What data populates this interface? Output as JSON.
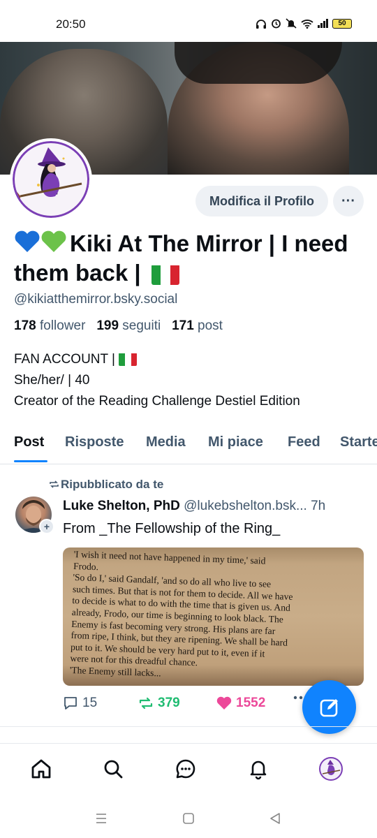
{
  "status_bar": {
    "time": "20:50",
    "battery": "50"
  },
  "profile": {
    "display_name": "Kiki At The Mirror | I need them back |",
    "handle": "@kikiatthemirror.bsky.social",
    "edit_button": "Modifica il Profilo",
    "more_button": "···",
    "stats": {
      "followers_count": "178",
      "followers_label": "follower",
      "following_count": "199",
      "following_label": "seguiti",
      "posts_count": "171",
      "posts_label": "post"
    },
    "bio": {
      "line1": "FAN ACCOUNT |",
      "line2": "She/her/ | 40",
      "line3": "Creator of the Reading Challenge Destiel Edition"
    }
  },
  "tabs": [
    "Post",
    "Risposte",
    "Media",
    "Mi piace",
    "Feed",
    "Starter"
  ],
  "active_tab": "Post",
  "post": {
    "repost_label": "Ripubblicato da te",
    "author": "Luke Shelton, PhD",
    "author_handle": "@lukebshelton.bsk...",
    "time": "7h",
    "text": "From _The Fellowship of the Ring_",
    "image_text": "'I wish it need not have happened in my time,' said\nFrodo.\n'So do I,' said Gandalf, 'and so do all who live to see\nsuch times. But that is not for them to decide. All we have\nto decide is what to do with the time that is given us. And\nalready, Frodo, our time is beginning to look black. The\nEnemy is fast becoming very strong. His plans are far\nfrom ripe, I think, but they are ripening. We shall be hard\nput to it. We should be very hard put to it, even if it\nwere not for this dreadful chance.\n'The Enemy still lacks...",
    "replies": "15",
    "reposts": "379",
    "likes": "1552"
  },
  "colors": {
    "accent": "#1083fe",
    "repost": "#20bc72",
    "like": "#ec4899",
    "muted": "#42576c"
  },
  "icons": {
    "bottom_nav": [
      "home-icon",
      "search-icon",
      "chat-icon",
      "bell-icon",
      "profile-avatar"
    ],
    "fab": "compose-icon"
  }
}
